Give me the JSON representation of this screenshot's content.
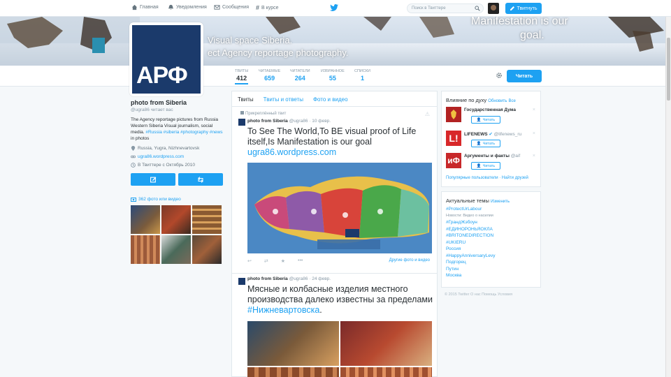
{
  "topnav": {
    "home": "Главная",
    "notifications": "Уведомления",
    "messages": "Сообщения",
    "discover": "В курсе",
    "search_placeholder": "Поиск в Твиттере",
    "tweet_button": "Твитнуть"
  },
  "banner": {
    "line1": "Visual space Siberia.",
    "line2": "ect Agency reportage photography.",
    "right1": "Manifestation is our",
    "right2": "goal."
  },
  "stats": [
    {
      "label": "Твиты",
      "value": "412"
    },
    {
      "label": "Читаемые",
      "value": "659"
    },
    {
      "label": "Читатели",
      "value": "264"
    },
    {
      "label": "Избранное",
      "value": "55"
    },
    {
      "label": "Списки",
      "value": "1"
    }
  ],
  "follow_button": "Читать",
  "profile": {
    "logo_text": "АРФ",
    "name": "photo from Siberia",
    "handle": "@ugra86 читает вас",
    "bio_text": "The Agency reportage pictures from Russia Western Siberia Visual journalism, social media.",
    "bio_tags": "#Russia #siberia #photography #news",
    "bio_tail": "in photos",
    "location": "Russia, Yugra, Nizhnevartovsk",
    "website": "ugra86.wordpress.com",
    "joined": "В Твиттере с Октябрь 2010",
    "photos_label": "362 фото или видео"
  },
  "timeline": {
    "tabs": [
      "Твиты",
      "Твиты и ответы",
      "Фото и видео"
    ],
    "pinned_label": "Прикреплённый твит",
    "tweet1": {
      "author": "photo from Siberia",
      "handle": "@ugra86",
      "time": "· 10 февр.",
      "text": "To See The World,To BE visual proof of Life itself,Is Manifestation is our goal",
      "link": "ugra86.wordpress.com",
      "more": "Другие фото и видео"
    },
    "tweet2": {
      "author": "photo from Siberia",
      "handle": "@ugra86",
      "time": "· 24 февр.",
      "text": "Мясные и колбасные изделия местного производства далеко известны за пределами",
      "hashtag": "#Нижневартовска",
      "suffix": "."
    }
  },
  "who_to_follow": {
    "title": "Влияние по духу",
    "refresh": "Обновить",
    "all": "Все",
    "items": [
      {
        "name": "Государственная Дума",
        "handle": "",
        "btn": "Читать"
      },
      {
        "name": "LIFENEWS",
        "handle": "@lifenews_ru",
        "btn": "Читать"
      },
      {
        "name": "Аргументы и факты",
        "handle": "@aif",
        "btn": "Читать"
      }
    ],
    "links": "Популярные пользователи · Найти друзей"
  },
  "trends": {
    "title": "Актуальные темы",
    "change": "Изменить",
    "items": [
      "#ProtectUrLabour",
      "Новости: Видео о насилии",
      "#ГрандЖэбоун",
      "#ЕДИНОРОНЬЯОКЛА",
      "#BRITONEDIRECTION",
      "#UKIERU",
      "Россия",
      "#HappyAnniversaryLevy",
      "Подгорец",
      "Путин",
      "Москва"
    ]
  },
  "footer": "© 2015 Twitter О нас Помощь Условия",
  "colors": {
    "accent": "#1da1f2",
    "logo_bg": "#1b3a6b"
  }
}
